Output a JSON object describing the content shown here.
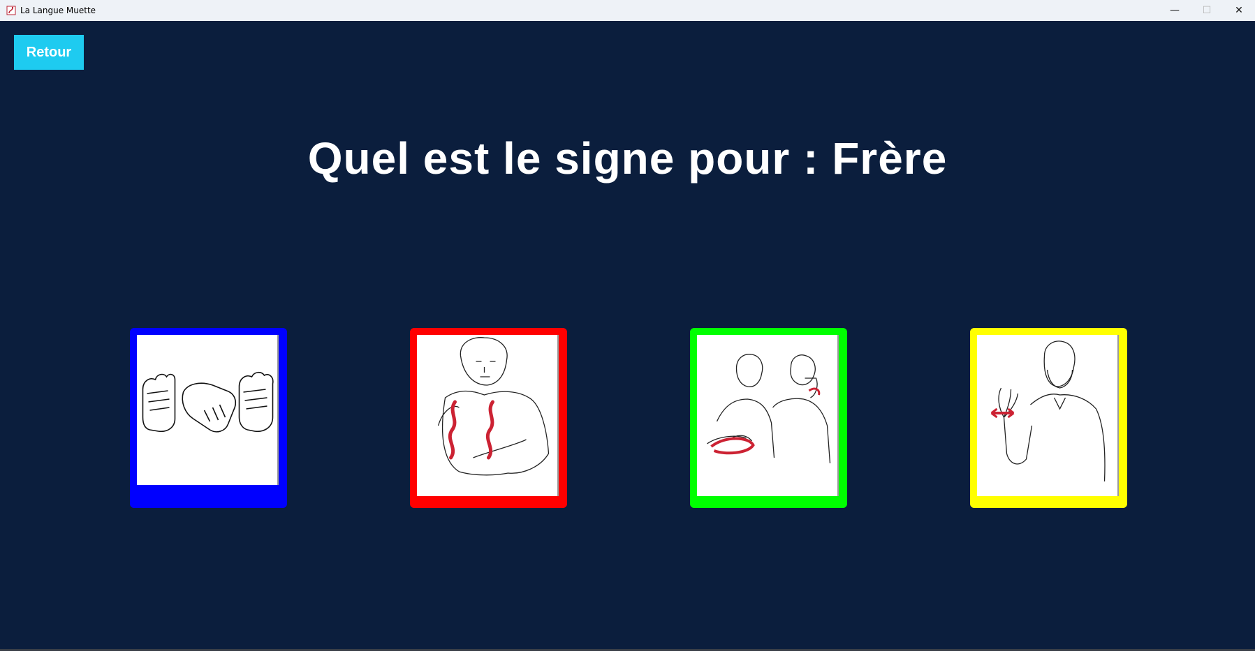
{
  "window": {
    "title": "La Langue Muette",
    "controls": {
      "minimize": "—",
      "maximize": "☐",
      "close": "✕"
    }
  },
  "toolbar": {
    "back_label": "Retour"
  },
  "quiz": {
    "question": "Quel est le signe pour : Frère",
    "choices": [
      {
        "icon": "fists-signs-icon",
        "color": "#0000ff"
      },
      {
        "icon": "person-chest-sign-icon",
        "color": "#ff0000"
      },
      {
        "icon": "two-people-sign-icon",
        "color": "#00ff00"
      },
      {
        "icon": "man-waving-sign-icon",
        "color": "#ffff00"
      }
    ]
  },
  "colors": {
    "background": "#0b1e3d",
    "accent": "#1ecbf0",
    "text": "#ffffff"
  }
}
